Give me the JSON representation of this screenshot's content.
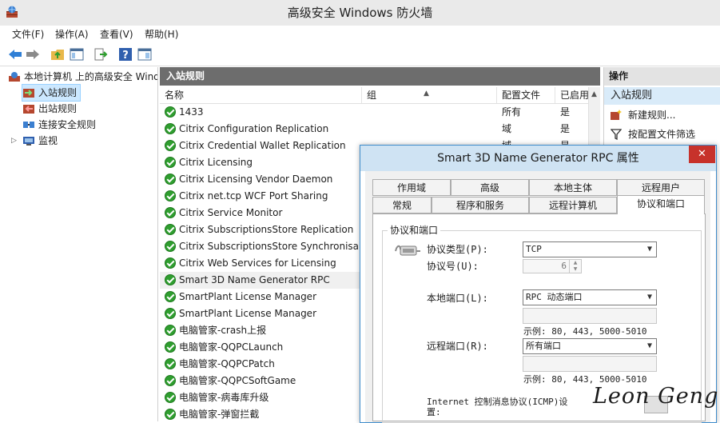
{
  "window": {
    "title": "高级安全 Windows 防火墙"
  },
  "menu": [
    "文件(F)",
    "操作(A)",
    "查看(V)",
    "帮助(H)"
  ],
  "toolbar": [
    "back-arrow-icon",
    "forward-arrow-icon",
    "up-folder-icon",
    "show-hide-tree-icon",
    "export-list-icon",
    "help-icon",
    "properties-pane-icon"
  ],
  "tree": {
    "root": "本地计算机 上的高级安全 Windows 防火墙",
    "items": [
      {
        "label": "入站规则",
        "selected": true
      },
      {
        "label": "出站规则",
        "selected": false
      },
      {
        "label": "连接安全规则",
        "selected": false
      },
      {
        "label": "监视",
        "selected": false
      }
    ]
  },
  "rules": {
    "header": "入站规则",
    "columns": {
      "name": "名称",
      "group": "组",
      "profile": "配置文件",
      "enabled": "已启用"
    },
    "rows": [
      {
        "name": "1433",
        "profile": "所有",
        "enabled": "是"
      },
      {
        "name": "Citrix Configuration Replication",
        "profile": "域",
        "enabled": "是"
      },
      {
        "name": "Citrix Credential Wallet Replication",
        "profile": "域",
        "enabled": "是"
      },
      {
        "name": "Citrix Licensing",
        "profile": "",
        "enabled": ""
      },
      {
        "name": "Citrix Licensing Vendor Daemon",
        "profile": "",
        "enabled": ""
      },
      {
        "name": "Citrix net.tcp WCF Port Sharing",
        "profile": "",
        "enabled": ""
      },
      {
        "name": "Citrix Service Monitor",
        "profile": "",
        "enabled": ""
      },
      {
        "name": "Citrix SubscriptionsStore Replication",
        "profile": "",
        "enabled": ""
      },
      {
        "name": "Citrix SubscriptionsStore Synchronisa...",
        "profile": "",
        "enabled": ""
      },
      {
        "name": "Citrix Web Services for Licensing",
        "profile": "",
        "enabled": ""
      },
      {
        "name": "Smart 3D Name Generator RPC",
        "profile": "",
        "enabled": ""
      },
      {
        "name": "SmartPlant License Manager",
        "profile": "",
        "enabled": ""
      },
      {
        "name": "SmartPlant License Manager",
        "profile": "",
        "enabled": ""
      },
      {
        "name": "电脑管家-crash上报",
        "profile": "",
        "enabled": ""
      },
      {
        "name": "电脑管家-QQPCLaunch",
        "profile": "",
        "enabled": ""
      },
      {
        "name": "电脑管家-QQPCPatch",
        "profile": "",
        "enabled": ""
      },
      {
        "name": "电脑管家-QQPCSoftGame",
        "profile": "",
        "enabled": ""
      },
      {
        "name": "电脑管家-病毒库升级",
        "profile": "",
        "enabled": ""
      },
      {
        "name": "电脑管家-弹窗拦截",
        "profile": "",
        "enabled": ""
      }
    ]
  },
  "actions": {
    "header": "操作",
    "section": "入站规则",
    "items": [
      {
        "label": "新建规则...",
        "icon": "new-rule-icon"
      },
      {
        "label": "按配置文件筛选",
        "icon": "filter-icon"
      }
    ]
  },
  "dialog": {
    "title": "Smart 3D Name Generator RPC 属性",
    "close": "✕",
    "tabs_top": [
      "作用域",
      "高级",
      "本地主体",
      "远程用户"
    ],
    "tabs_bottom": [
      "常规",
      "程序和服务",
      "远程计算机",
      "协议和端口"
    ],
    "active_tab": "协议和端口",
    "group_label": "协议和端口",
    "protocol_type_label": "协议类型(P):",
    "protocol_type_value": "TCP",
    "protocol_number_label": "协议号(U):",
    "protocol_number_value": "6",
    "local_port_label": "本地端口(L):",
    "local_port_value": "RPC 动态端口",
    "local_example": "示例: 80, 443, 5000-5010",
    "remote_port_label": "远程端口(R):",
    "remote_port_value": "所有端口",
    "remote_example": "示例: 80, 443, 5000-5010",
    "icmp_label_line1": "Internet 控制消息协议(ICMP)设",
    "icmp_label_line2": "置:"
  },
  "watermark": "Leon Geng",
  "colors": {
    "selection": "#cce8ff",
    "rules_header": "#6d6d6d",
    "action_section": "#d9ebf9",
    "enabled_check": "#2f9e2f",
    "dialog_close": "#c7322b"
  }
}
